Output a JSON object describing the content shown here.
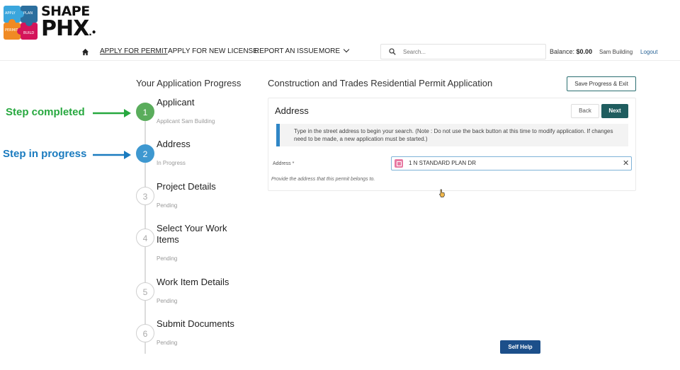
{
  "logo": {
    "line1": "SHAPE",
    "line2": "PHX",
    "piece_labels": [
      "PLAN",
      "PERMIT",
      "APPLY",
      "BUILD"
    ]
  },
  "nav": {
    "home_icon": "home-icon",
    "items": [
      "APPLY FOR PERMIT",
      "APPLY FOR NEW LICENSE",
      "REPORT AN ISSUE",
      "MORE"
    ],
    "search_placeholder": "Search...",
    "balance_label": "Balance:",
    "balance_value": "$0.00",
    "user": "Sam Building",
    "logout": "Logout"
  },
  "progress": {
    "title": "Your Application Progress",
    "steps": [
      {
        "number": "1",
        "title": "Applicant",
        "status": "Applicant  Sam Building"
      },
      {
        "number": "2",
        "title": "Address",
        "status": "In Progress"
      },
      {
        "number": "3",
        "title": "Project Details",
        "status": "Pending"
      },
      {
        "number": "4",
        "title": "Select Your Work Items",
        "status": "Pending"
      },
      {
        "number": "5",
        "title": "Work Item Details",
        "status": "Pending"
      },
      {
        "number": "6",
        "title": "Submit Documents",
        "status": "Pending"
      }
    ]
  },
  "annotations": {
    "completed": "Step completed",
    "in_progress": "Step in progress"
  },
  "main": {
    "title": "Construction and Trades Residential Permit Application",
    "save_button": "Save Progress & Exit",
    "card_title": "Address",
    "back": "Back",
    "next": "Next",
    "info": "Type in the street address to begin your search. (Note : Do not use the back button at this time to modify application. If changes need to be made, a new application must be started.)",
    "address_label": "Address *",
    "address_value": "1 N STANDARD PLAN DR",
    "address_help": "Provide the address that this permit belongs to."
  },
  "self_help": "Self Help",
  "colors": {
    "done": "#5aad5c",
    "current": "#3e98d0",
    "primary": "#1f5d5f",
    "annot_green": "#27a83f",
    "annot_blue": "#1a7bbf"
  }
}
